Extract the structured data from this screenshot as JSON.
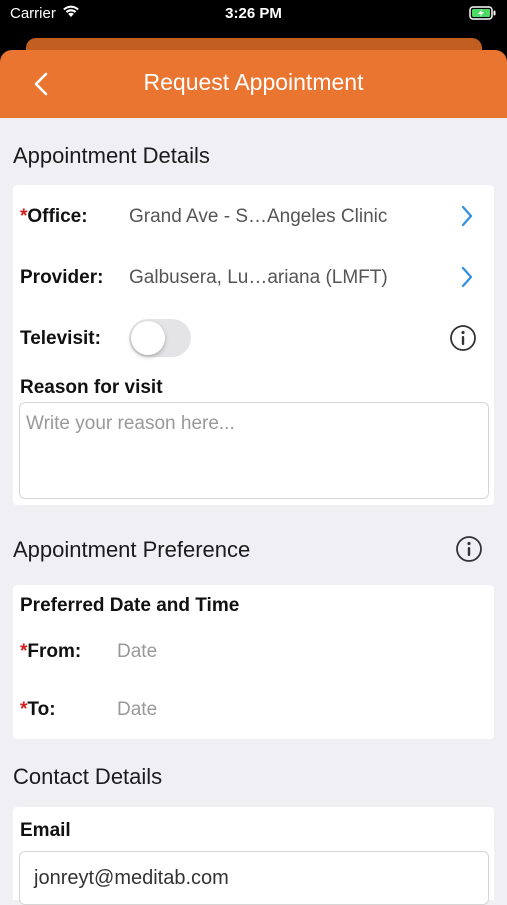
{
  "status_bar": {
    "carrier": "Carrier",
    "time": "3:26 PM"
  },
  "header": {
    "title": "Request Appointment",
    "back_icon": "chevron-left-icon",
    "color": "#ea7530"
  },
  "appointment_details": {
    "title": "Appointment Details",
    "office": {
      "required_mark": "*",
      "label": "Office:",
      "value": "Grand Ave - S…Angeles Clinic"
    },
    "provider": {
      "label": "Provider:",
      "value": "Galbusera, Lu…ariana (LMFT)"
    },
    "televisit": {
      "label": "Televisit:",
      "enabled": false
    },
    "reason": {
      "label": "Reason for visit",
      "placeholder": "Write your reason here..."
    }
  },
  "appointment_preference": {
    "title": "Appointment Preference",
    "subtitle": "Preferred Date and Time",
    "from": {
      "required_mark": "*",
      "label": "From:",
      "placeholder": "Date"
    },
    "to": {
      "required_mark": "*",
      "label": "To:",
      "placeholder": "Date"
    }
  },
  "contact_details": {
    "title": "Contact Details",
    "email": {
      "label": "Email",
      "value": "jonreyt@meditab.com"
    }
  },
  "colors": {
    "accent": "#ea7530",
    "link_blue": "#2f8fe0",
    "required_red": "#d11f1f"
  }
}
